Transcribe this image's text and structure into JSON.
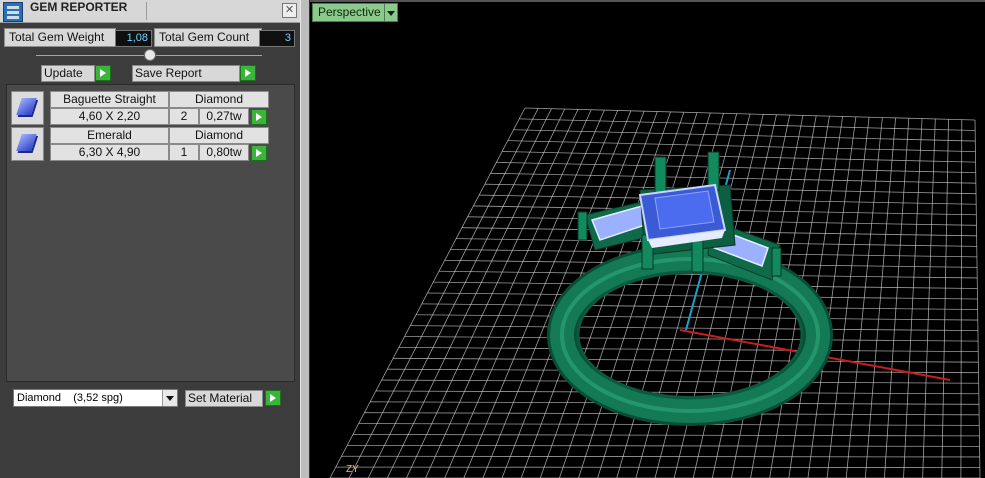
{
  "window": {
    "title": "GEM REPORTER",
    "close_glyph": "✕"
  },
  "summary": {
    "weight_label": "Total Gem Weight",
    "weight_value": "1,08",
    "count_label": "Total Gem Count",
    "count_value": "3"
  },
  "buttons": {
    "update": "Update",
    "save_report": "Save Report",
    "set_material": "Set Material"
  },
  "gems": [
    {
      "shape": "Baguette Straight",
      "material": "Diamond",
      "size": "4,60 X 2,20",
      "qty": "2",
      "weight": "0,27tw"
    },
    {
      "shape": "Emerald",
      "material": "Diamond",
      "size": "6,30 X 4,90",
      "qty": "1",
      "weight": "0,80tw"
    }
  ],
  "material_select": {
    "value": "Diamond",
    "density": "(3,52 spg)"
  },
  "viewport": {
    "view_name": "Perspective",
    "axis_label": "ZY"
  },
  "icons": {
    "app": "gem-reporter-app-icon",
    "gem": "gem-icon",
    "go": "green-play-arrow-icon",
    "close": "close-icon",
    "dropdown": "chevron-down-icon"
  },
  "colors": {
    "grid": "#cfcfcf",
    "ring": "#0f6a4a",
    "gem": "#3b5bd6",
    "x_axis": "#c81e1e",
    "y_axis": "#1aa3c7",
    "tab": "#8cc98c"
  }
}
